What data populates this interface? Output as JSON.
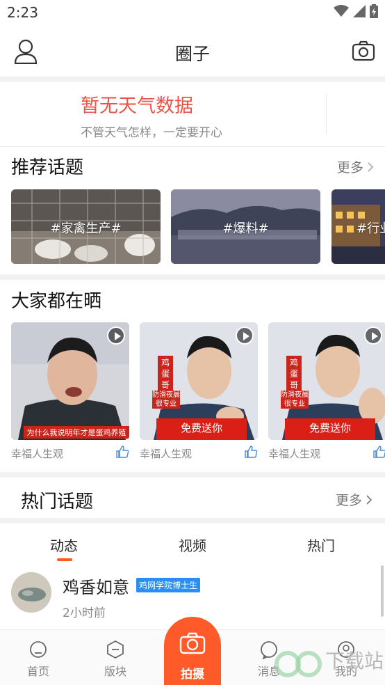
{
  "status_bar": {
    "time": "2:23"
  },
  "header": {
    "title": "圈子"
  },
  "weather": {
    "title": "暂无天气数据",
    "subtitle": "不管天气怎样，一定要开心"
  },
  "recommend": {
    "title": "推荐话题",
    "more": "更多",
    "topics": [
      {
        "label": "#家禽生产#"
      },
      {
        "label": "#爆料#"
      },
      {
        "label": "#行业"
      }
    ]
  },
  "showcase": {
    "title": "大家都在晒",
    "videos": [
      {
        "author": "幸福人生观",
        "caption": "为什么我说明年才是蛋鸡养殖"
      },
      {
        "author": "幸福人生观",
        "tag": "鸡蛋哥",
        "tag_sub": "防滑夜晨很专业",
        "banner": "免费送你"
      },
      {
        "author": "幸福人生观",
        "tag": "鸡蛋哥",
        "tag_sub": "防滑夜晨很专业",
        "banner": "免费送你"
      }
    ]
  },
  "hot": {
    "title": "热门话题",
    "more": "更多"
  },
  "feed_tabs": {
    "items": [
      "动态",
      "视频",
      "热门"
    ],
    "active": 0
  },
  "post": {
    "name": "鸡香如意",
    "badge": "鸡网学院博士生",
    "time": "2小时前"
  },
  "bottom_nav": {
    "home": "首页",
    "board": "版块",
    "shoot": "拍摄",
    "message": "消息",
    "mine": "我的"
  },
  "watermark": {
    "text": "下载站"
  },
  "colors": {
    "accent": "#ff5a2a",
    "weather": "#e85545",
    "badge": "#2c8df3"
  }
}
